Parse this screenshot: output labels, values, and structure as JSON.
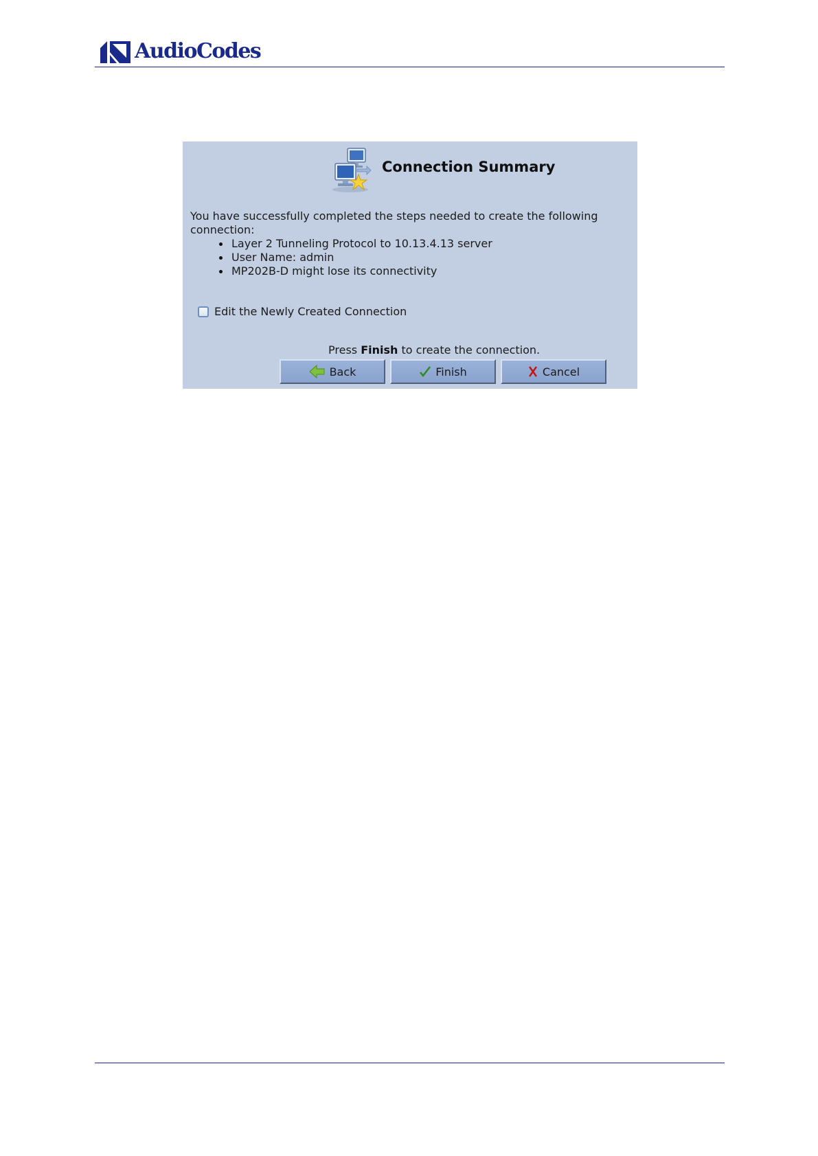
{
  "header": {
    "logo_text": "AudioCodes"
  },
  "dialog": {
    "title": "Connection Summary",
    "intro": "You have successfully completed the steps needed to create the following connection:",
    "items": [
      "Layer 2 Tunneling Protocol to 10.13.4.13 server",
      "User Name: admin",
      "MP202B-D might lose its connectivity"
    ],
    "checkbox_label": "Edit the Newly Created Connection",
    "checkbox_checked": false,
    "press_prefix": "Press",
    "press_bold": "Finish",
    "press_suffix": "to create the connection.",
    "buttons": {
      "back": "Back",
      "finish": "Finish",
      "cancel": "Cancel"
    },
    "icons": {
      "title": "wizard-computer-icon",
      "back": "back-arrow-icon",
      "finish": "checkmark-icon",
      "cancel": "cross-icon"
    }
  },
  "colors": {
    "brand": "#1a2a8a",
    "dialog_background": "#c2cfe2",
    "button_face": "#8ea7d0"
  }
}
